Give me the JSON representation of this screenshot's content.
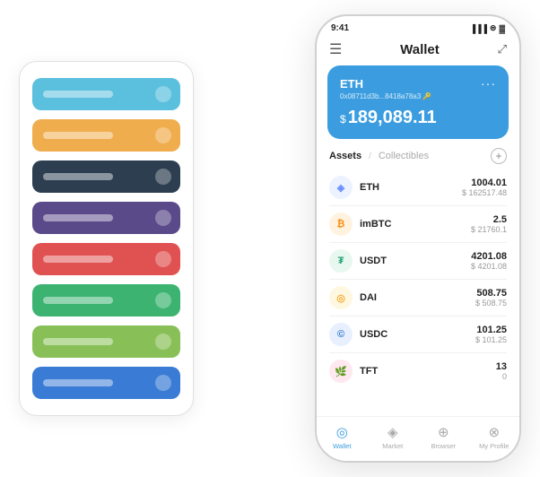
{
  "scene": {
    "card_stack": {
      "items": [
        {
          "color": "#5bc0de",
          "line_color": "rgba(255,255,255,0.4)"
        },
        {
          "color": "#f0ad4e",
          "line_color": "rgba(255,255,255,0.4)"
        },
        {
          "color": "#2c3e50",
          "line_color": "rgba(255,255,255,0.4)"
        },
        {
          "color": "#5b4a8a",
          "line_color": "rgba(255,255,255,0.4)"
        },
        {
          "color": "#e05252",
          "line_color": "rgba(255,255,255,0.4)"
        },
        {
          "color": "#3cb371",
          "line_color": "rgba(255,255,255,0.4)"
        },
        {
          "color": "#88c057",
          "line_color": "rgba(255,255,255,0.4)"
        },
        {
          "color": "#3a7bd5",
          "line_color": "rgba(255,255,255,0.4)"
        }
      ]
    },
    "phone": {
      "status_bar": {
        "time": "9:41",
        "signal": "▐▐▐",
        "wifi": "WiFi",
        "battery": "🔋"
      },
      "nav": {
        "menu_icon": "☰",
        "title": "Wallet",
        "expand_icon": "⤢"
      },
      "eth_card": {
        "label": "ETH",
        "dots": "···",
        "address": "0x08711d3b...8418a78a3 🔑",
        "dollar_sign": "$",
        "balance": "189,089.11",
        "bg_color": "#3b9de0"
      },
      "assets_header": {
        "active_tab": "Assets",
        "divider": "/",
        "inactive_tab": "Collectibles",
        "add_icon": "+"
      },
      "assets": [
        {
          "symbol": "ETH",
          "name": "ETH",
          "amount": "1004.01",
          "usd": "$ 162517.48",
          "icon_emoji": "◈",
          "icon_bg": "#ecf3ff",
          "icon_color": "#6b8fff"
        },
        {
          "symbol": "imBTC",
          "name": "imBTC",
          "amount": "2.5",
          "usd": "$ 21760.1",
          "icon_emoji": "₿",
          "icon_bg": "#fff3e0",
          "icon_color": "#f7931a"
        },
        {
          "symbol": "USDT",
          "name": "USDT",
          "amount": "4201.08",
          "usd": "$ 4201.08",
          "icon_emoji": "₮",
          "icon_bg": "#e8f8f0",
          "icon_color": "#26a17b"
        },
        {
          "symbol": "DAI",
          "name": "DAI",
          "amount": "508.75",
          "usd": "$ 508.75",
          "icon_emoji": "◎",
          "icon_bg": "#fff8e0",
          "icon_color": "#f5ac37"
        },
        {
          "symbol": "USDC",
          "name": "USDC",
          "amount": "101.25",
          "usd": "$ 101.25",
          "icon_emoji": "©",
          "icon_bg": "#e8f0ff",
          "icon_color": "#2775ca"
        },
        {
          "symbol": "TFT",
          "name": "TFT",
          "amount": "13",
          "usd": "0",
          "icon_emoji": "🌿",
          "icon_bg": "#ffe8f0",
          "icon_color": "#e0547a"
        }
      ],
      "bottom_nav": [
        {
          "icon": "◎",
          "label": "Wallet",
          "active": true
        },
        {
          "icon": "📊",
          "label": "Market",
          "active": false
        },
        {
          "icon": "🌐",
          "label": "Browser",
          "active": false
        },
        {
          "icon": "👤",
          "label": "My Profile",
          "active": false
        }
      ]
    }
  }
}
